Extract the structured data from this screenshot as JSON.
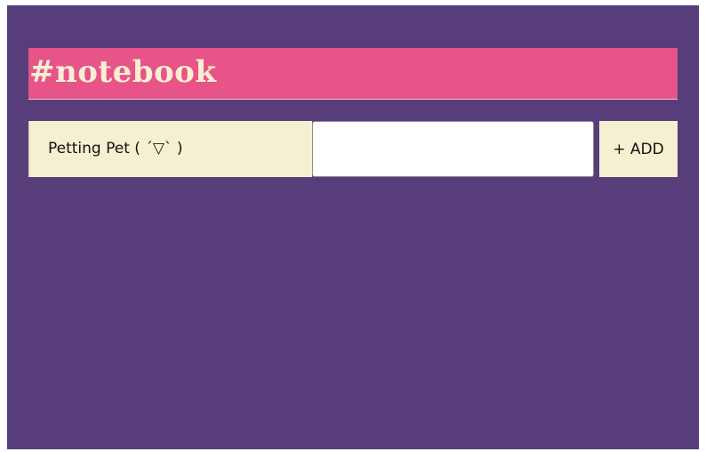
{
  "header": {
    "title": "#notebook"
  },
  "form": {
    "item_label": "Petting Pet ( ´▽` )",
    "input_value": "",
    "add_button_label": "+ ADD"
  },
  "colors": {
    "background": "#573d7a",
    "title_bar": "#e75489",
    "title_text": "#f7efd2",
    "panel": "#f6f0d2"
  }
}
